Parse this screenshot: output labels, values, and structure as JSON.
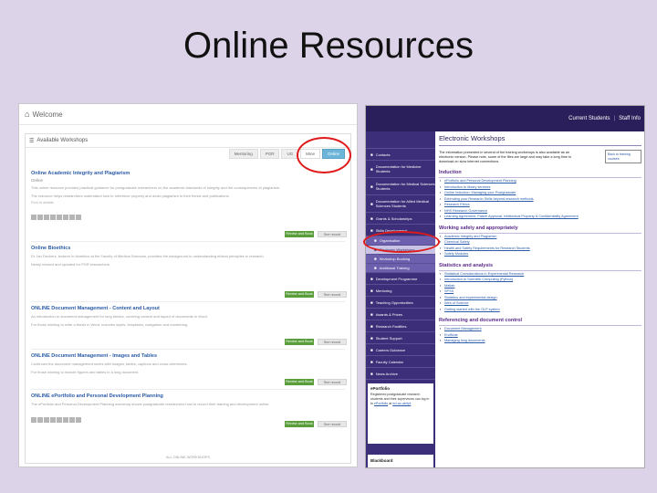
{
  "slide": {
    "title": "Online Resources"
  },
  "left": {
    "welcome": "Welcome",
    "panel_heading": "Available Workshops",
    "filters": [
      "Mentoring",
      "PGR",
      "UG",
      "Mine",
      "Online"
    ],
    "workshops": [
      {
        "title": "Online Academic Integrity and Plagiarism",
        "sub": "Online",
        "desc": [
          "This online resource provides practical guidance for postgraduate researchers on the academic standards of integrity and the consequences of plagiarism.",
          "The resource helps researchers understand how to reference properly and avoid plagiarism in their thesis and publications."
        ],
        "foot": "Find in details",
        "squares": 8
      },
      {
        "title": "Online Bioethics",
        "sub": "",
        "desc": [
          "Dr Jan Deckers, lecturer in bioethics at the Faculty of Medical Sciences, provides the background to understanding ethical principles in research.",
          "Newly revised and updated for PGR researchers."
        ],
        "foot": "",
        "squares": 0
      },
      {
        "title": "ONLINE Document Management - Content and Layout",
        "sub": "",
        "desc": [
          "An introduction to document management for long theses, covering content and layout of documents in Word.",
          "For those wishing to write a thesis in Word; includes styles, templates, navigation and numbering."
        ],
        "foot": "",
        "squares": 0
      },
      {
        "title": "ONLINE Document Management - Images and Tables",
        "sub": "",
        "desc": [
          "Continues the document management series with images, tables, captions and cross-references.",
          "For those wishing to include figures and tables in a long document."
        ],
        "foot": "",
        "squares": 0
      },
      {
        "title": "ONLINE ePortfolio and Personal Development Planning",
        "sub": "",
        "desc": [
          "The ePortfolio and Personal Development Planning workshop shows postgraduate researchers how to record their training and development online."
        ],
        "foot": "",
        "squares": 8
      }
    ],
    "view_label": "Review and Book",
    "alt_label": "See record",
    "footer": "ALL ONLINE WORKSHOPS"
  },
  "right": {
    "top_links": [
      "Current Students",
      "Staff Info"
    ],
    "sidebar": [
      {
        "label": "Contacts",
        "kind": "item"
      },
      {
        "label": "Documentation for Medicine Students",
        "kind": "tall"
      },
      {
        "label": "Documentation for Medical Sciences Students",
        "kind": "tall"
      },
      {
        "label": "Documentation for Allied Medical Sciences Students",
        "kind": "tall"
      },
      {
        "label": "Grants & Scholarships",
        "kind": "item"
      },
      {
        "label": "Skills Development",
        "kind": "item"
      },
      {
        "label": "Organisation",
        "kind": "sub"
      },
      {
        "label": "Electronic Workshops",
        "kind": "sub-active"
      },
      {
        "label": "Workshop Booking",
        "kind": "sub"
      },
      {
        "label": "Additional Training",
        "kind": "sub"
      },
      {
        "label": "Development Programme",
        "kind": "item"
      },
      {
        "label": "Mentoring",
        "kind": "item"
      },
      {
        "label": "Teaching Opportunities",
        "kind": "item"
      },
      {
        "label": "Awards & Prizes",
        "kind": "item"
      },
      {
        "label": "Research Facilities",
        "kind": "item"
      },
      {
        "label": "Student Support",
        "kind": "item"
      },
      {
        "label": "Careers Guidance",
        "kind": "item"
      },
      {
        "label": "Faculty Calendar",
        "kind": "item"
      },
      {
        "label": "News Archive",
        "kind": "item"
      }
    ],
    "eportfolio": {
      "title": "ePortfolio",
      "text": "Registered postgraduate research students and their supervisors can log in to ",
      "link1": "ePortfolio",
      "mid": " at ",
      "link2": "ncl.ac.uk/epf"
    },
    "blackboard": "Blackboard",
    "heading": "Electronic Workshops",
    "note": "The information presented in several of the training workshops is also available as an electronic version. Please note, some of the files are large and may take a long time to download on slow internet connections.",
    "note_box": "Back to training courses",
    "sections": [
      {
        "title": "Induction",
        "links": [
          "ePortfolio and Personal Development Planning",
          "Introduction to library services",
          "Online Induction: Managing your Postgraduate",
          "Extending your Research Skills beyond research methods",
          "Research Ethics",
          "NHS Research Governance",
          "Learning Agreement, Patent Approval, Intellectual Property & Confidentiality Agreement"
        ]
      },
      {
        "title": "Working safely and appropriately",
        "links": [
          "Academic Integrity and Plagiarism",
          "Chemical Safety",
          "Health and Safety Requirements for Research Students",
          "Safety Modules"
        ]
      },
      {
        "title": "Statistics and analysis",
        "links": [
          "Statistical Considerations in Experimental Research",
          "Introduction to Scientific Computing (Python)",
          "Matlab",
          "SPSS",
          "Statistics and experimental design",
          "Web of Science",
          "Getting started with the GLP system"
        ]
      },
      {
        "title": "Referencing and document control",
        "links": [
          "Document Management",
          "EndNote",
          "Managing long documents"
        ]
      }
    ]
  }
}
